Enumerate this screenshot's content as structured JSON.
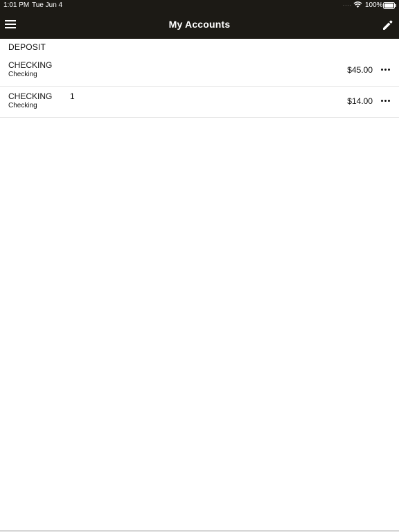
{
  "status_bar": {
    "time": "1:01 PM",
    "date": "Tue Jun 4",
    "signal_dots": "....",
    "wifi_icon": "wifi-icon",
    "battery_percent": "100%",
    "battery_icon": "battery-icon"
  },
  "nav": {
    "title": "My Accounts",
    "menu_icon": "hamburger-menu-icon",
    "edit_icon": "pencil-icon"
  },
  "section": {
    "title": "DEPOSIT"
  },
  "accounts": [
    {
      "name": "CHECKING",
      "number": "",
      "type": "Checking",
      "balance": "$45.00",
      "more_icon": "ellipsis-icon"
    },
    {
      "name": "CHECKING",
      "number": "1",
      "type": "Checking",
      "balance": "$14.00",
      "more_icon": "ellipsis-icon"
    }
  ],
  "colors": {
    "bar_background": "#1c1a15",
    "bar_text": "#ffffff",
    "row_divider": "#e6e6e6"
  }
}
